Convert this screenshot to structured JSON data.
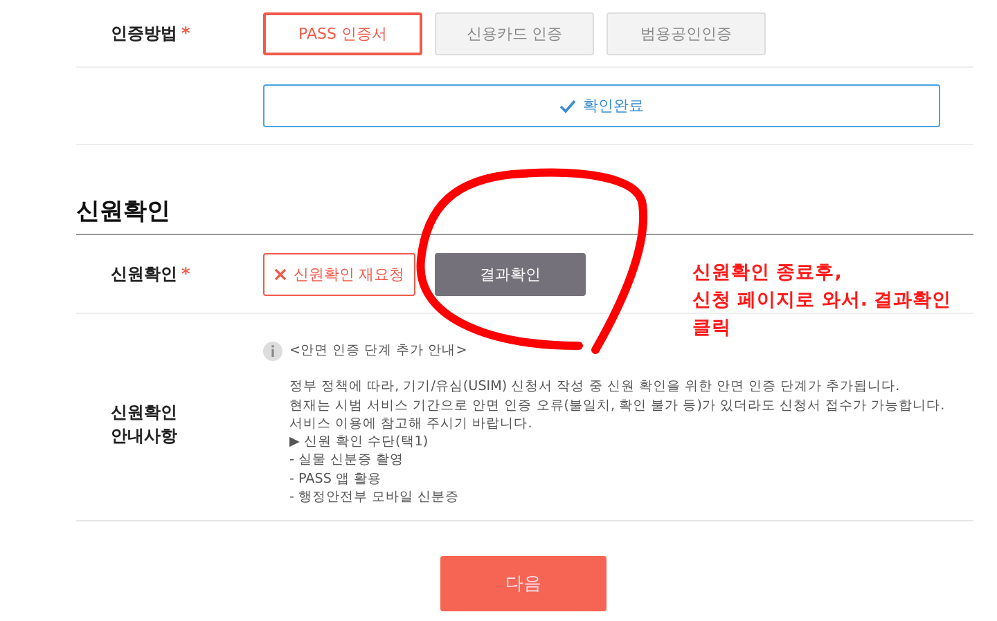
{
  "auth_method": {
    "label": "인증방법",
    "required_mark": "*",
    "options": [
      {
        "label": "PASS 인증서",
        "selected": true
      },
      {
        "label": "신용카드 인증",
        "selected": false
      },
      {
        "label": "범용공인인증",
        "selected": false
      }
    ]
  },
  "confirm_button": {
    "label": "확인완료"
  },
  "section_title": "신원확인",
  "identity_check": {
    "label": "신원확인",
    "required_mark": "*",
    "buttons": [
      {
        "kind": "outline",
        "label": "신원확인 재요청"
      },
      {
        "kind": "filled",
        "label": "결과확인"
      }
    ]
  },
  "notice": {
    "label_lines": [
      "신원확인",
      "안내사항"
    ],
    "title": "<안면 인증 단계 추가 안내>",
    "lines": [
      "정부 정책에 따라, 기기/유심(USIM) 신청서 작성 중 신원 확인을 위한 안면 인증 단계가 추가됩니다.",
      "현재는 시범 서비스 기간으로 안면 인증 오류(불일치, 확인 불가 등)가 있더라도 신청서 접수가 가능합니다.",
      "서비스 이용에 참고해 주시기 바랍니다.",
      "▶ 신원 확인 수단(택1)",
      "- 실물 신분증 촬영",
      "- PASS 앱 활용",
      "- 행정안전부 모바일 신분증"
    ]
  },
  "next_button": {
    "label": "다음"
  },
  "annotation": {
    "lines": [
      "신원확인 종료후,",
      "신청 페이지로 와서. 결과확인",
      "클릭"
    ]
  }
}
